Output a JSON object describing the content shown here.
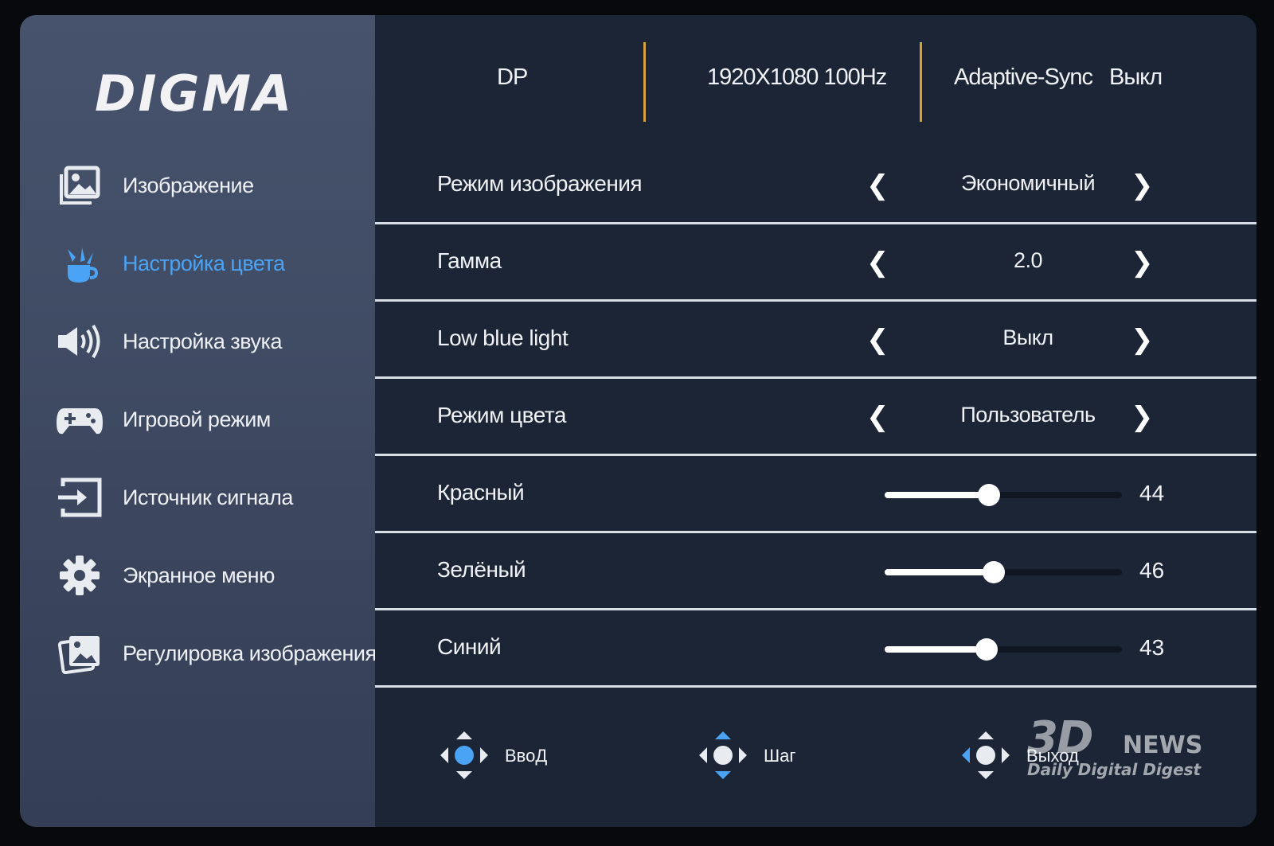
{
  "brand": "DIGMA",
  "status": {
    "input": "DP",
    "resolution": "1920X1080 100Hz",
    "adaptive_sync_label": "Adaptive-Sync",
    "adaptive_sync_value": "Выкл"
  },
  "sidebar": {
    "items": [
      {
        "label": "Изображение",
        "icon": "image-icon",
        "active": false
      },
      {
        "label": "Настройка цвета",
        "icon": "color-palette-icon",
        "active": true
      },
      {
        "label": "Настройка звука",
        "icon": "speaker-icon",
        "active": false
      },
      {
        "label": "Игровой режим",
        "icon": "gamepad-icon",
        "active": false
      },
      {
        "label": "Источник сигнала",
        "icon": "input-source-icon",
        "active": false
      },
      {
        "label": "Экранное меню",
        "icon": "gear-icon",
        "active": false
      },
      {
        "label": "Регулировка изображения",
        "icon": "image-adjust-icon",
        "active": false
      }
    ]
  },
  "settings": {
    "picture_mode": {
      "label": "Режим изображения",
      "value": "Экономичный"
    },
    "gamma": {
      "label": "Гамма",
      "value": "2.0"
    },
    "low_blue_light": {
      "label": "Low blue light",
      "value": "Выкл"
    },
    "color_mode": {
      "label": "Режим цвета",
      "value": "Пользователь"
    },
    "red": {
      "label": "Красный",
      "value": "44",
      "level": 44
    },
    "green": {
      "label": "Зелёный",
      "value": "46",
      "level": 46
    },
    "blue": {
      "label": "Синий",
      "value": "43",
      "level": 43
    }
  },
  "footer": {
    "enter": {
      "label": "ВвоД",
      "icon": "joystick-enter-icon"
    },
    "step": {
      "label": "Шаг",
      "icon": "joystick-step-icon"
    },
    "exit": {
      "label": "Выход",
      "icon": "joystick-exit-icon"
    }
  },
  "watermark": {
    "main": "3D",
    "news": "NEWS",
    "tagline": "Daily Digital Digest"
  },
  "colors": {
    "accent": "#4aa3f5",
    "separator_gold": "#d4a23a",
    "panel": "#1b2536",
    "sidebar": "#434f68"
  }
}
